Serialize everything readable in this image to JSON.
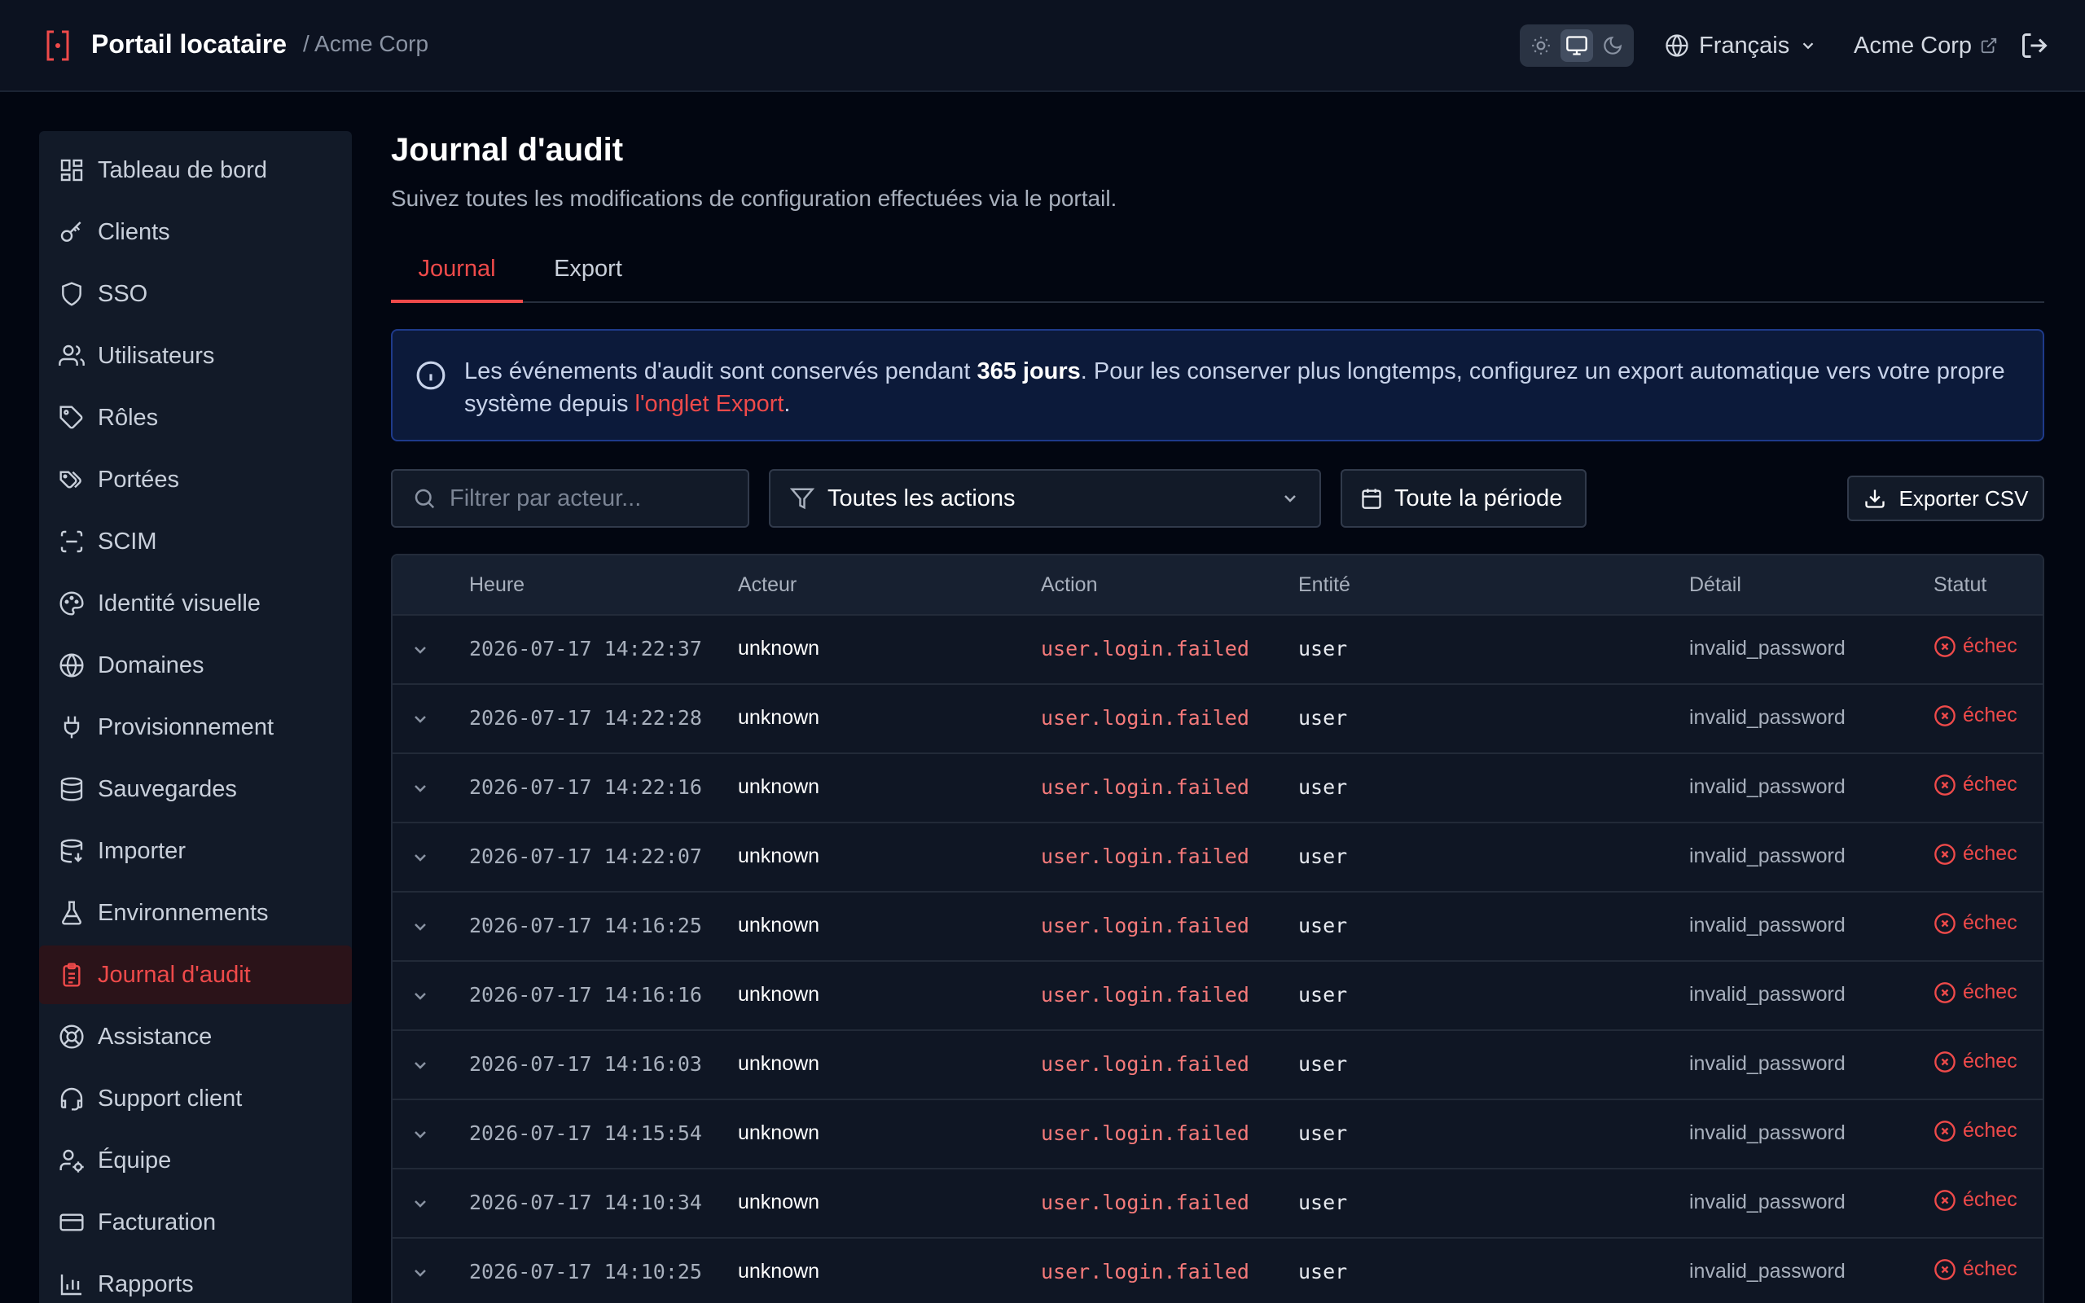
{
  "header": {
    "app_title": "Portail locataire",
    "org_crumb": "/ Acme Corp",
    "language": "Français",
    "org_link": "Acme Corp"
  },
  "sidebar": {
    "items": [
      {
        "label": "Tableau de bord",
        "icon": "dashboard-icon"
      },
      {
        "label": "Clients",
        "icon": "key-icon"
      },
      {
        "label": "SSO",
        "icon": "shield-icon"
      },
      {
        "label": "Utilisateurs",
        "icon": "users-icon"
      },
      {
        "label": "Rôles",
        "icon": "tag-icon"
      },
      {
        "label": "Portées",
        "icon": "tags-icon"
      },
      {
        "label": "SCIM",
        "icon": "scan-icon"
      },
      {
        "label": "Identité visuelle",
        "icon": "palette-icon"
      },
      {
        "label": "Domaines",
        "icon": "globe-icon"
      },
      {
        "label": "Provisionnement",
        "icon": "plug-icon"
      },
      {
        "label": "Sauvegardes",
        "icon": "database-icon"
      },
      {
        "label": "Importer",
        "icon": "database-import-icon"
      },
      {
        "label": "Environnements",
        "icon": "flask-icon"
      },
      {
        "label": "Journal d'audit",
        "icon": "clipboard-icon",
        "active": true
      },
      {
        "label": "Assistance",
        "icon": "lifebuoy-icon"
      },
      {
        "label": "Support client",
        "icon": "headset-icon"
      },
      {
        "label": "Équipe",
        "icon": "user-cog-icon"
      },
      {
        "label": "Facturation",
        "icon": "credit-card-icon"
      },
      {
        "label": "Rapports",
        "icon": "bar-chart-icon"
      }
    ]
  },
  "page": {
    "title": "Journal d'audit",
    "subtitle": "Suivez toutes les modifications de configuration effectuées via le portail."
  },
  "tabs": {
    "journal": "Journal",
    "export": "Export"
  },
  "notice": {
    "text_before": "Les événements d'audit sont conservés pendant ",
    "bold": "365 jours",
    "text_after": ". Pour les conserver plus longtemps, configurez un export automatique vers votre propre système depuis ",
    "link": "l'onglet Export",
    "text_end": "."
  },
  "filters": {
    "actor_placeholder": "Filtrer par acteur...",
    "actions_value": "Toutes les actions",
    "period_value": "Toute la période",
    "export_label": "Exporter CSV"
  },
  "table": {
    "headers": {
      "time": "Heure",
      "actor": "Acteur",
      "action": "Action",
      "entity": "Entité",
      "detail": "Détail",
      "status": "Statut"
    },
    "rows": [
      {
        "time": "2026-07-17 14:22:37",
        "actor": "unknown",
        "action": "user.login.failed",
        "entity": "user",
        "detail": "invalid_password",
        "status": "échec"
      },
      {
        "time": "2026-07-17 14:22:28",
        "actor": "unknown",
        "action": "user.login.failed",
        "entity": "user",
        "detail": "invalid_password",
        "status": "échec"
      },
      {
        "time": "2026-07-17 14:22:16",
        "actor": "unknown",
        "action": "user.login.failed",
        "entity": "user",
        "detail": "invalid_password",
        "status": "échec"
      },
      {
        "time": "2026-07-17 14:22:07",
        "actor": "unknown",
        "action": "user.login.failed",
        "entity": "user",
        "detail": "invalid_password",
        "status": "échec"
      },
      {
        "time": "2026-07-17 14:16:25",
        "actor": "unknown",
        "action": "user.login.failed",
        "entity": "user",
        "detail": "invalid_password",
        "status": "échec"
      },
      {
        "time": "2026-07-17 14:16:16",
        "actor": "unknown",
        "action": "user.login.failed",
        "entity": "user",
        "detail": "invalid_password",
        "status": "échec"
      },
      {
        "time": "2026-07-17 14:16:03",
        "actor": "unknown",
        "action": "user.login.failed",
        "entity": "user",
        "detail": "invalid_password",
        "status": "échec"
      },
      {
        "time": "2026-07-17 14:15:54",
        "actor": "unknown",
        "action": "user.login.failed",
        "entity": "user",
        "detail": "invalid_password",
        "status": "échec"
      },
      {
        "time": "2026-07-17 14:10:34",
        "actor": "unknown",
        "action": "user.login.failed",
        "entity": "user",
        "detail": "invalid_password",
        "status": "échec"
      },
      {
        "time": "2026-07-17 14:10:25",
        "actor": "unknown",
        "action": "user.login.failed",
        "entity": "user",
        "detail": "invalid_password",
        "status": "échec"
      }
    ]
  },
  "colors": {
    "accent": "#ef4a4a",
    "background": "#020611",
    "surface": "#121a28",
    "notice_bg": "#0c1a3a",
    "notice_border": "#1e3a8a"
  }
}
